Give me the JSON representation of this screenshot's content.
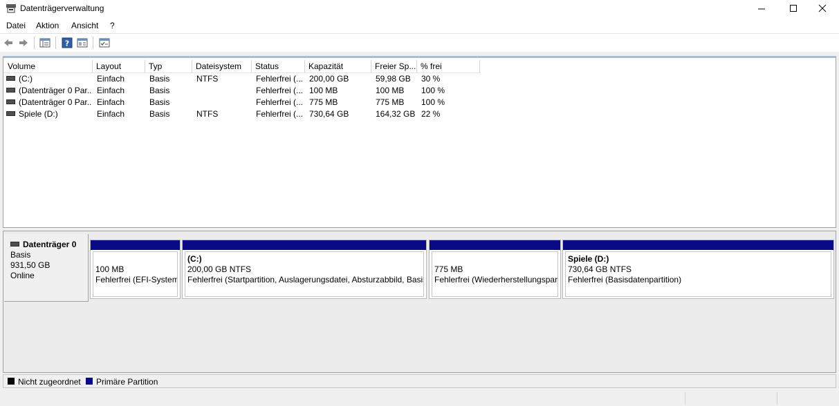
{
  "window": {
    "title": "Datenträgerverwaltung"
  },
  "menu": [
    "Datei",
    "Aktion",
    "Ansicht",
    "?"
  ],
  "toolbar": [
    "back-icon",
    "forward-icon",
    "list-view-icon",
    "help-icon",
    "properties-icon",
    "settings-icon"
  ],
  "table": {
    "columns": [
      "Volume",
      "Layout",
      "Typ",
      "Dateisystem",
      "Status",
      "Kapazität",
      "Freier Sp...",
      "% frei"
    ],
    "rows": [
      [
        "(C:)",
        "Einfach",
        "Basis",
        "NTFS",
        "Fehlerfrei (...",
        "200,00 GB",
        "59,98 GB",
        "30 %"
      ],
      [
        "(Datenträger 0 Par...",
        "Einfach",
        "Basis",
        "",
        "Fehlerfrei (...",
        "100 MB",
        "100 MB",
        "100 %"
      ],
      [
        "(Datenträger 0 Par...",
        "Einfach",
        "Basis",
        "",
        "Fehlerfrei (...",
        "775 MB",
        "775 MB",
        "100 %"
      ],
      [
        "Spiele (D:)",
        "Einfach",
        "Basis",
        "NTFS",
        "Fehlerfrei (...",
        "730,64 GB",
        "164,32 GB",
        "22 %"
      ]
    ]
  },
  "disk": {
    "name": "Datenträger 0",
    "type": "Basis",
    "size": "931,50 GB",
    "state": "Online",
    "partitions": [
      {
        "title": "",
        "size": "100 MB",
        "status": "Fehlerfrei (EFI-Systempartition)"
      },
      {
        "title": "(C:)",
        "size": "200,00 GB NTFS",
        "status": "Fehlerfrei (Startpartition, Auslagerungsdatei, Absturzabbild, Basisdatenpartition)"
      },
      {
        "title": "",
        "size": "775 MB",
        "status": "Fehlerfrei (Wiederherstellungspartition)"
      },
      {
        "title": "Spiele  (D:)",
        "size": "730,64 GB NTFS",
        "status": "Fehlerfrei (Basisdatenpartition)"
      }
    ]
  },
  "legend": [
    {
      "label": "Nicht zugeordnet",
      "color": "#000000"
    },
    {
      "label": "Primäre Partition",
      "color": "#0a0a85"
    }
  ],
  "colors": {
    "partition_bar": "#0a0a85",
    "header_accent": "#a6bdd8"
  }
}
